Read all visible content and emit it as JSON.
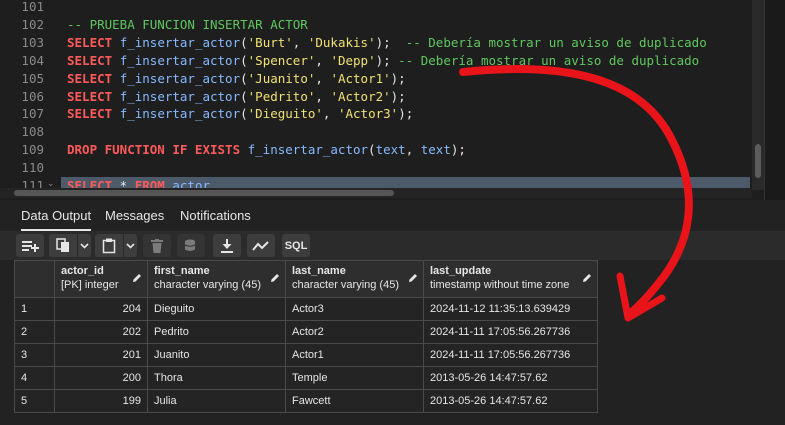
{
  "editor": {
    "lines": [
      {
        "num": "101",
        "tokens": [],
        "selected": false
      },
      {
        "num": "102",
        "tokens": [
          {
            "t": "-- PRUEBA FUNCION INSERTAR ACTOR",
            "c": "cmt"
          }
        ],
        "selected": false
      },
      {
        "num": "103",
        "tokens": [
          {
            "t": "SELECT",
            "c": "kw"
          },
          {
            "t": " ",
            "c": "punc"
          },
          {
            "t": "f_insertar_actor",
            "c": "fn"
          },
          {
            "t": "(",
            "c": "punc"
          },
          {
            "t": "'Burt'",
            "c": "str"
          },
          {
            "t": ", ",
            "c": "punc"
          },
          {
            "t": "'Dukakis'",
            "c": "str"
          },
          {
            "t": ");  ",
            "c": "punc"
          },
          {
            "t": "-- Debería mostrar un aviso de duplicado",
            "c": "cmt"
          }
        ],
        "selected": false
      },
      {
        "num": "104",
        "tokens": [
          {
            "t": "SELECT",
            "c": "kw"
          },
          {
            "t": " ",
            "c": "punc"
          },
          {
            "t": "f_insertar_actor",
            "c": "fn"
          },
          {
            "t": "(",
            "c": "punc"
          },
          {
            "t": "'Spencer'",
            "c": "str"
          },
          {
            "t": ", ",
            "c": "punc"
          },
          {
            "t": "'Depp'",
            "c": "str"
          },
          {
            "t": "); ",
            "c": "punc"
          },
          {
            "t": "-- Debería mostrar un aviso de duplicado",
            "c": "cmt"
          }
        ],
        "selected": false
      },
      {
        "num": "105",
        "tokens": [
          {
            "t": "SELECT",
            "c": "kw"
          },
          {
            "t": " ",
            "c": "punc"
          },
          {
            "t": "f_insertar_actor",
            "c": "fn"
          },
          {
            "t": "(",
            "c": "punc"
          },
          {
            "t": "'Juanito'",
            "c": "str"
          },
          {
            "t": ", ",
            "c": "punc"
          },
          {
            "t": "'Actor1'",
            "c": "str"
          },
          {
            "t": ");",
            "c": "punc"
          }
        ],
        "selected": false
      },
      {
        "num": "106",
        "tokens": [
          {
            "t": "SELECT",
            "c": "kw"
          },
          {
            "t": " ",
            "c": "punc"
          },
          {
            "t": "f_insertar_actor",
            "c": "fn"
          },
          {
            "t": "(",
            "c": "punc"
          },
          {
            "t": "'Pedrito'",
            "c": "str"
          },
          {
            "t": ", ",
            "c": "punc"
          },
          {
            "t": "'Actor2'",
            "c": "str"
          },
          {
            "t": ");",
            "c": "punc"
          }
        ],
        "selected": false
      },
      {
        "num": "107",
        "tokens": [
          {
            "t": "SELECT",
            "c": "kw"
          },
          {
            "t": " ",
            "c": "punc"
          },
          {
            "t": "f_insertar_actor",
            "c": "fn"
          },
          {
            "t": "(",
            "c": "punc"
          },
          {
            "t": "'Dieguito'",
            "c": "str"
          },
          {
            "t": ", ",
            "c": "punc"
          },
          {
            "t": "'Actor3'",
            "c": "str"
          },
          {
            "t": ");",
            "c": "punc"
          }
        ],
        "selected": false
      },
      {
        "num": "108",
        "tokens": [],
        "selected": false
      },
      {
        "num": "109",
        "tokens": [
          {
            "t": "DROP FUNCTION IF EXISTS",
            "c": "kw"
          },
          {
            "t": " ",
            "c": "punc"
          },
          {
            "t": "f_insertar_actor",
            "c": "fn"
          },
          {
            "t": "(",
            "c": "punc"
          },
          {
            "t": "text",
            "c": "fn"
          },
          {
            "t": ", ",
            "c": "punc"
          },
          {
            "t": "text",
            "c": "fn"
          },
          {
            "t": ");",
            "c": "punc"
          }
        ],
        "selected": false
      },
      {
        "num": "110",
        "tokens": [],
        "selected": false
      },
      {
        "num": "111",
        "tokens": [
          {
            "t": "SELECT",
            "c": "kw"
          },
          {
            "t": " * ",
            "c": "op"
          },
          {
            "t": "FROM",
            "c": "kw"
          },
          {
            "t": " ",
            "c": "punc"
          },
          {
            "t": "actor",
            "c": "fn"
          }
        ],
        "selected": true,
        "fold": "⌄"
      }
    ]
  },
  "tabs": [
    {
      "label": "Data Output",
      "active": true
    },
    {
      "label": "Messages",
      "active": false
    },
    {
      "label": "Notifications",
      "active": false
    }
  ],
  "toolbar": {
    "sql_label": "SQL"
  },
  "grid": {
    "columns": [
      {
        "name": "actor_id",
        "type": "[PK] integer"
      },
      {
        "name": "first_name",
        "type": "character varying (45)"
      },
      {
        "name": "last_name",
        "type": "character varying (45)"
      },
      {
        "name": "last_update",
        "type": "timestamp without time zone"
      }
    ],
    "rows": [
      {
        "n": "1",
        "actor_id": "204",
        "first_name": "Dieguito",
        "last_name": "Actor3",
        "last_update": "2024-11-12 11:35:13.639429"
      },
      {
        "n": "2",
        "actor_id": "202",
        "first_name": "Pedrito",
        "last_name": "Actor2",
        "last_update": "2024-11-11 17:05:56.267736"
      },
      {
        "n": "3",
        "actor_id": "201",
        "first_name": "Juanito",
        "last_name": "Actor1",
        "last_update": "2024-11-11 17:05:56.267736"
      },
      {
        "n": "4",
        "actor_id": "200",
        "first_name": "Thora",
        "last_name": "Temple",
        "last_update": "2013-05-26 14:47:57.62"
      },
      {
        "n": "5",
        "actor_id": "199",
        "first_name": "Julia",
        "last_name": "Fawcett",
        "last_update": "2013-05-26 14:47:57.62"
      }
    ]
  },
  "colors": {
    "keyword": "#ff5a5a",
    "string": "#f1e173",
    "comment": "#5fc75f",
    "identifier": "#86b9ff",
    "selection": "#4c5a6a",
    "annotation_arrow": "#e8141a"
  }
}
